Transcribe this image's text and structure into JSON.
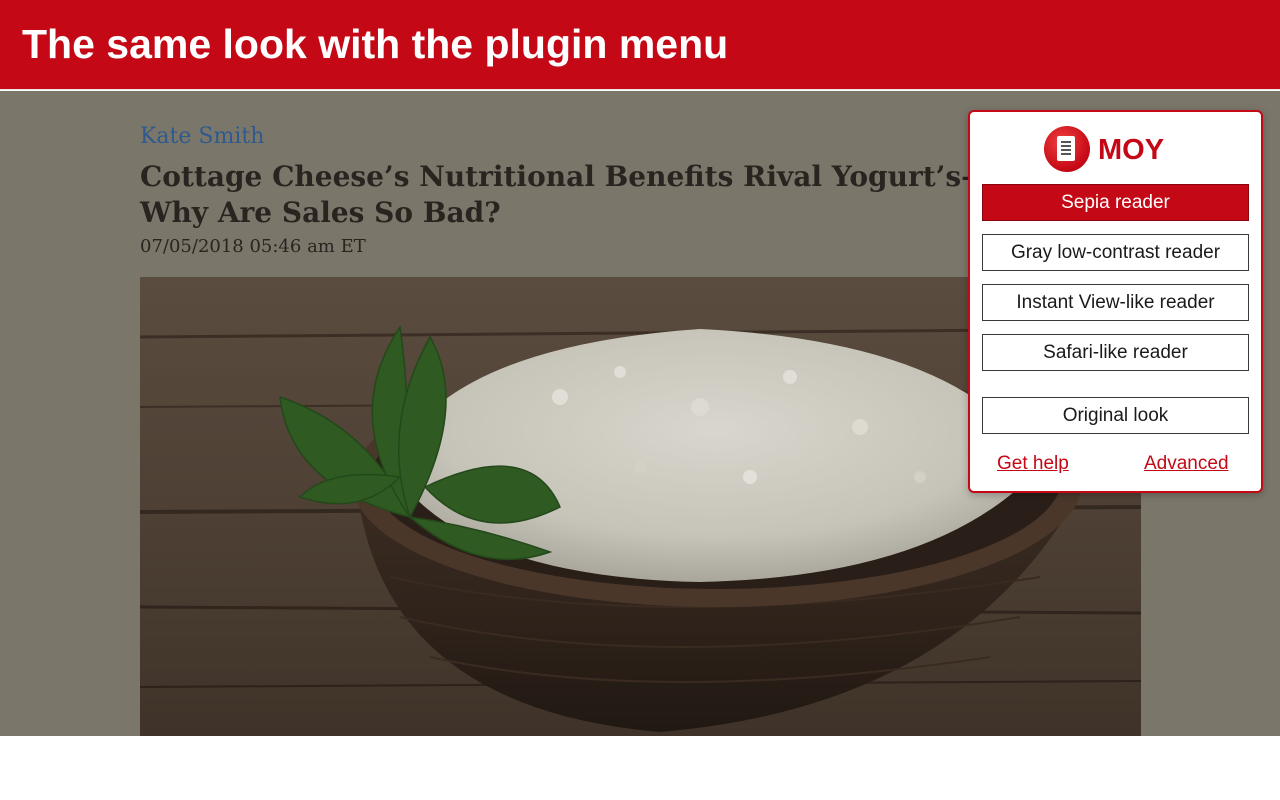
{
  "banner": {
    "title": "The same look with the plugin menu"
  },
  "article": {
    "author": "Kate Smith",
    "headline": "Cottage Cheese’s Nutritional Benefits Rival Yogurt’s— Why Are Sales So Bad?",
    "date": "07/05/2018 05:46 am ET",
    "image": "bowl-of-cottage-cheese-with-mint"
  },
  "plugin_menu": {
    "logo_icon": "document-icon",
    "brand": "MOY",
    "options": [
      {
        "label": "Sepia reader",
        "active": true
      },
      {
        "label": "Gray low-contrast reader",
        "active": false
      },
      {
        "label": "Instant View-like reader",
        "active": false
      },
      {
        "label": "Safari-like reader",
        "active": false
      },
      {
        "label": "Original look",
        "active": false
      }
    ],
    "links": {
      "help": "Get help",
      "advanced": "Advanced"
    }
  },
  "colors": {
    "accent": "#c40815",
    "overlay": "#7b766a",
    "author_link": "#2e5a8e"
  }
}
